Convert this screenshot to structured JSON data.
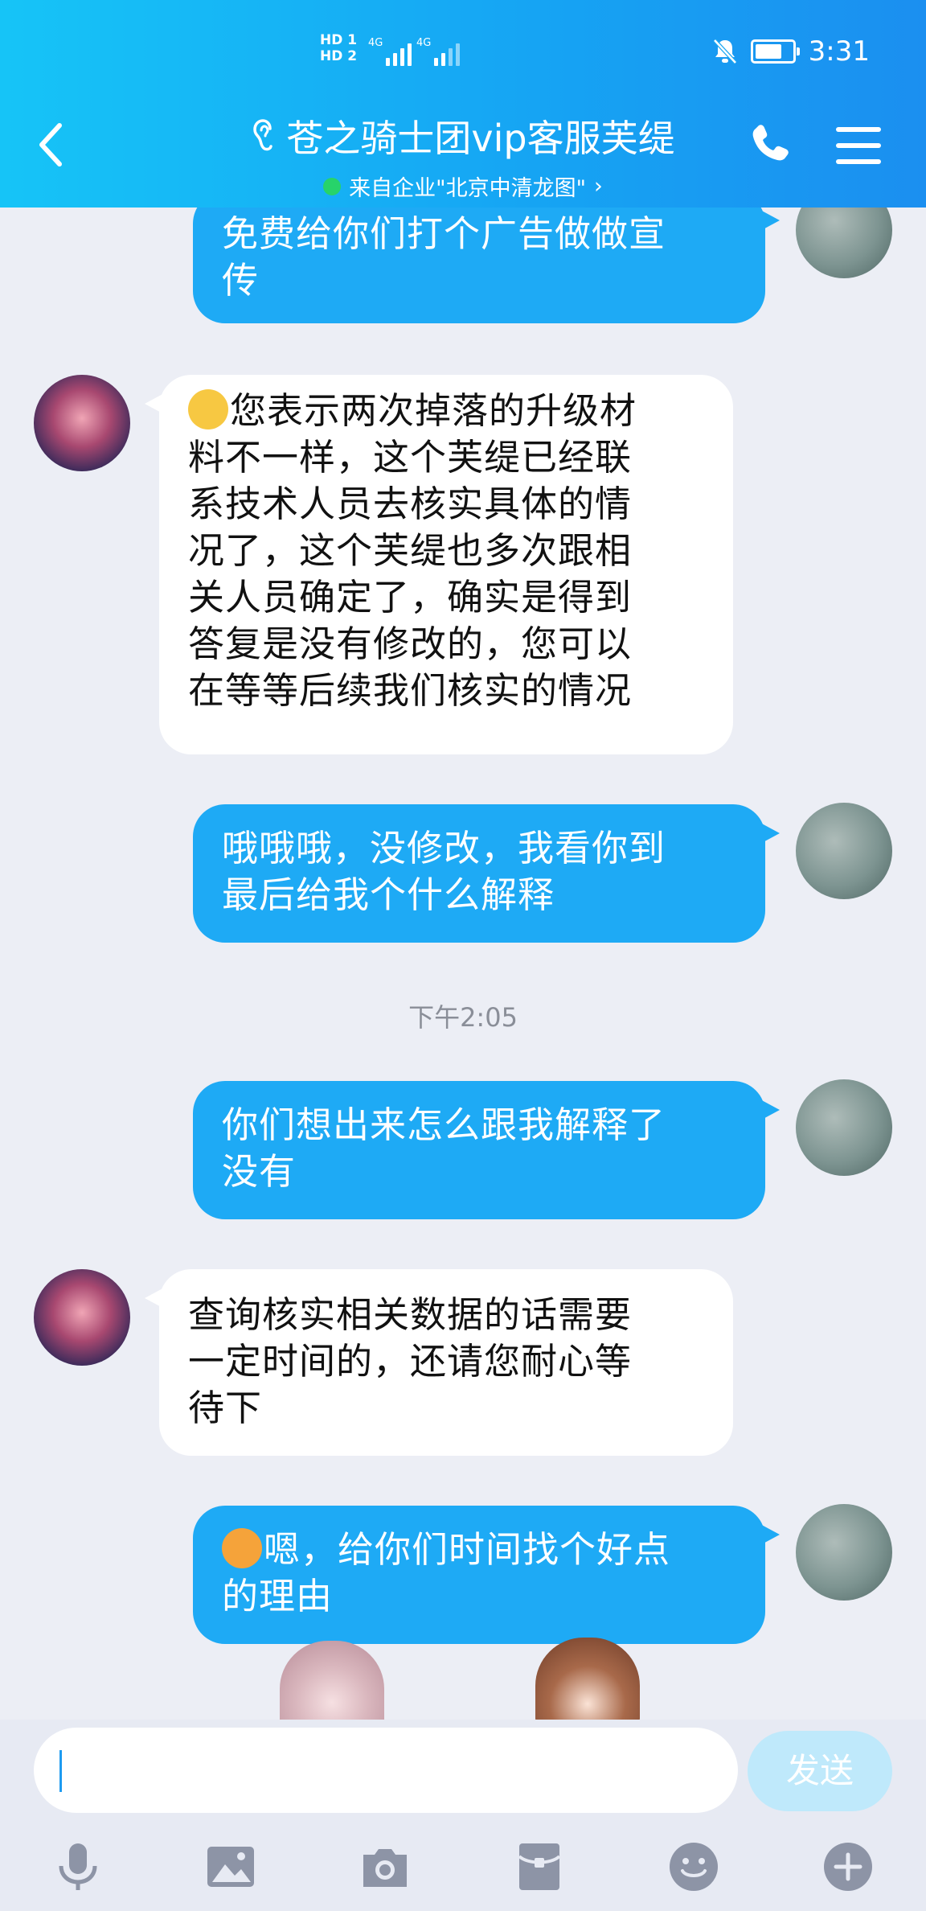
{
  "status_bar": {
    "sim1": "HD 1",
    "sim2": "HD 2",
    "network1": "4G",
    "network2": "4G",
    "time": "3:31"
  },
  "header": {
    "title": "苍之骑士团vip客服芙缇",
    "subtitle": "来自企业\"北京中清龙图\"",
    "chevron": "›"
  },
  "messages": [
    {
      "side": "out",
      "text_lines": [
        "免费给你们打个广告做做宣",
        "传"
      ]
    },
    {
      "side": "in",
      "emoji": "sleepy-emoji",
      "text_lines": [
        "您表示两次掉落的升级材",
        "料不一样，这个芙缇已经联",
        "系技术人员去核实具体的情",
        "况了，这个芙缇也多次跟相",
        "关人员确定了，确实是得到",
        "答复是没有修改的，您可以",
        "在等等后续我们核实的情况"
      ]
    },
    {
      "side": "out",
      "text_lines": [
        "哦哦哦，没修改，我看你到",
        "最后给我个什么解释"
      ]
    },
    {
      "side": "out",
      "text_lines": [
        "你们想出来怎么跟我解释了",
        "没有"
      ]
    },
    {
      "side": "in",
      "text_lines": [
        "查询核实相关数据的话需要",
        "一定时间的，还请您耐心等",
        "待下"
      ]
    },
    {
      "side": "out",
      "emoji": "dog-emoji",
      "text_lines": [
        "嗯，给你们时间找个好点",
        "的理由"
      ]
    }
  ],
  "timestamp": "下午2:05",
  "input": {
    "value": "",
    "send_label": "发送"
  },
  "toolbar": [
    "microphone-icon",
    "image-icon",
    "camera-icon",
    "red-packet-icon",
    "emoji-icon",
    "plus-icon"
  ],
  "colors": {
    "header_gradient_start": "#16c4f7",
    "header_gradient_end": "#1b8ff0",
    "outgoing_bubble": "#1eaaf5",
    "incoming_bubble": "#ffffff",
    "background": "#eceef5",
    "send_disabled": "#bfe9fb"
  }
}
